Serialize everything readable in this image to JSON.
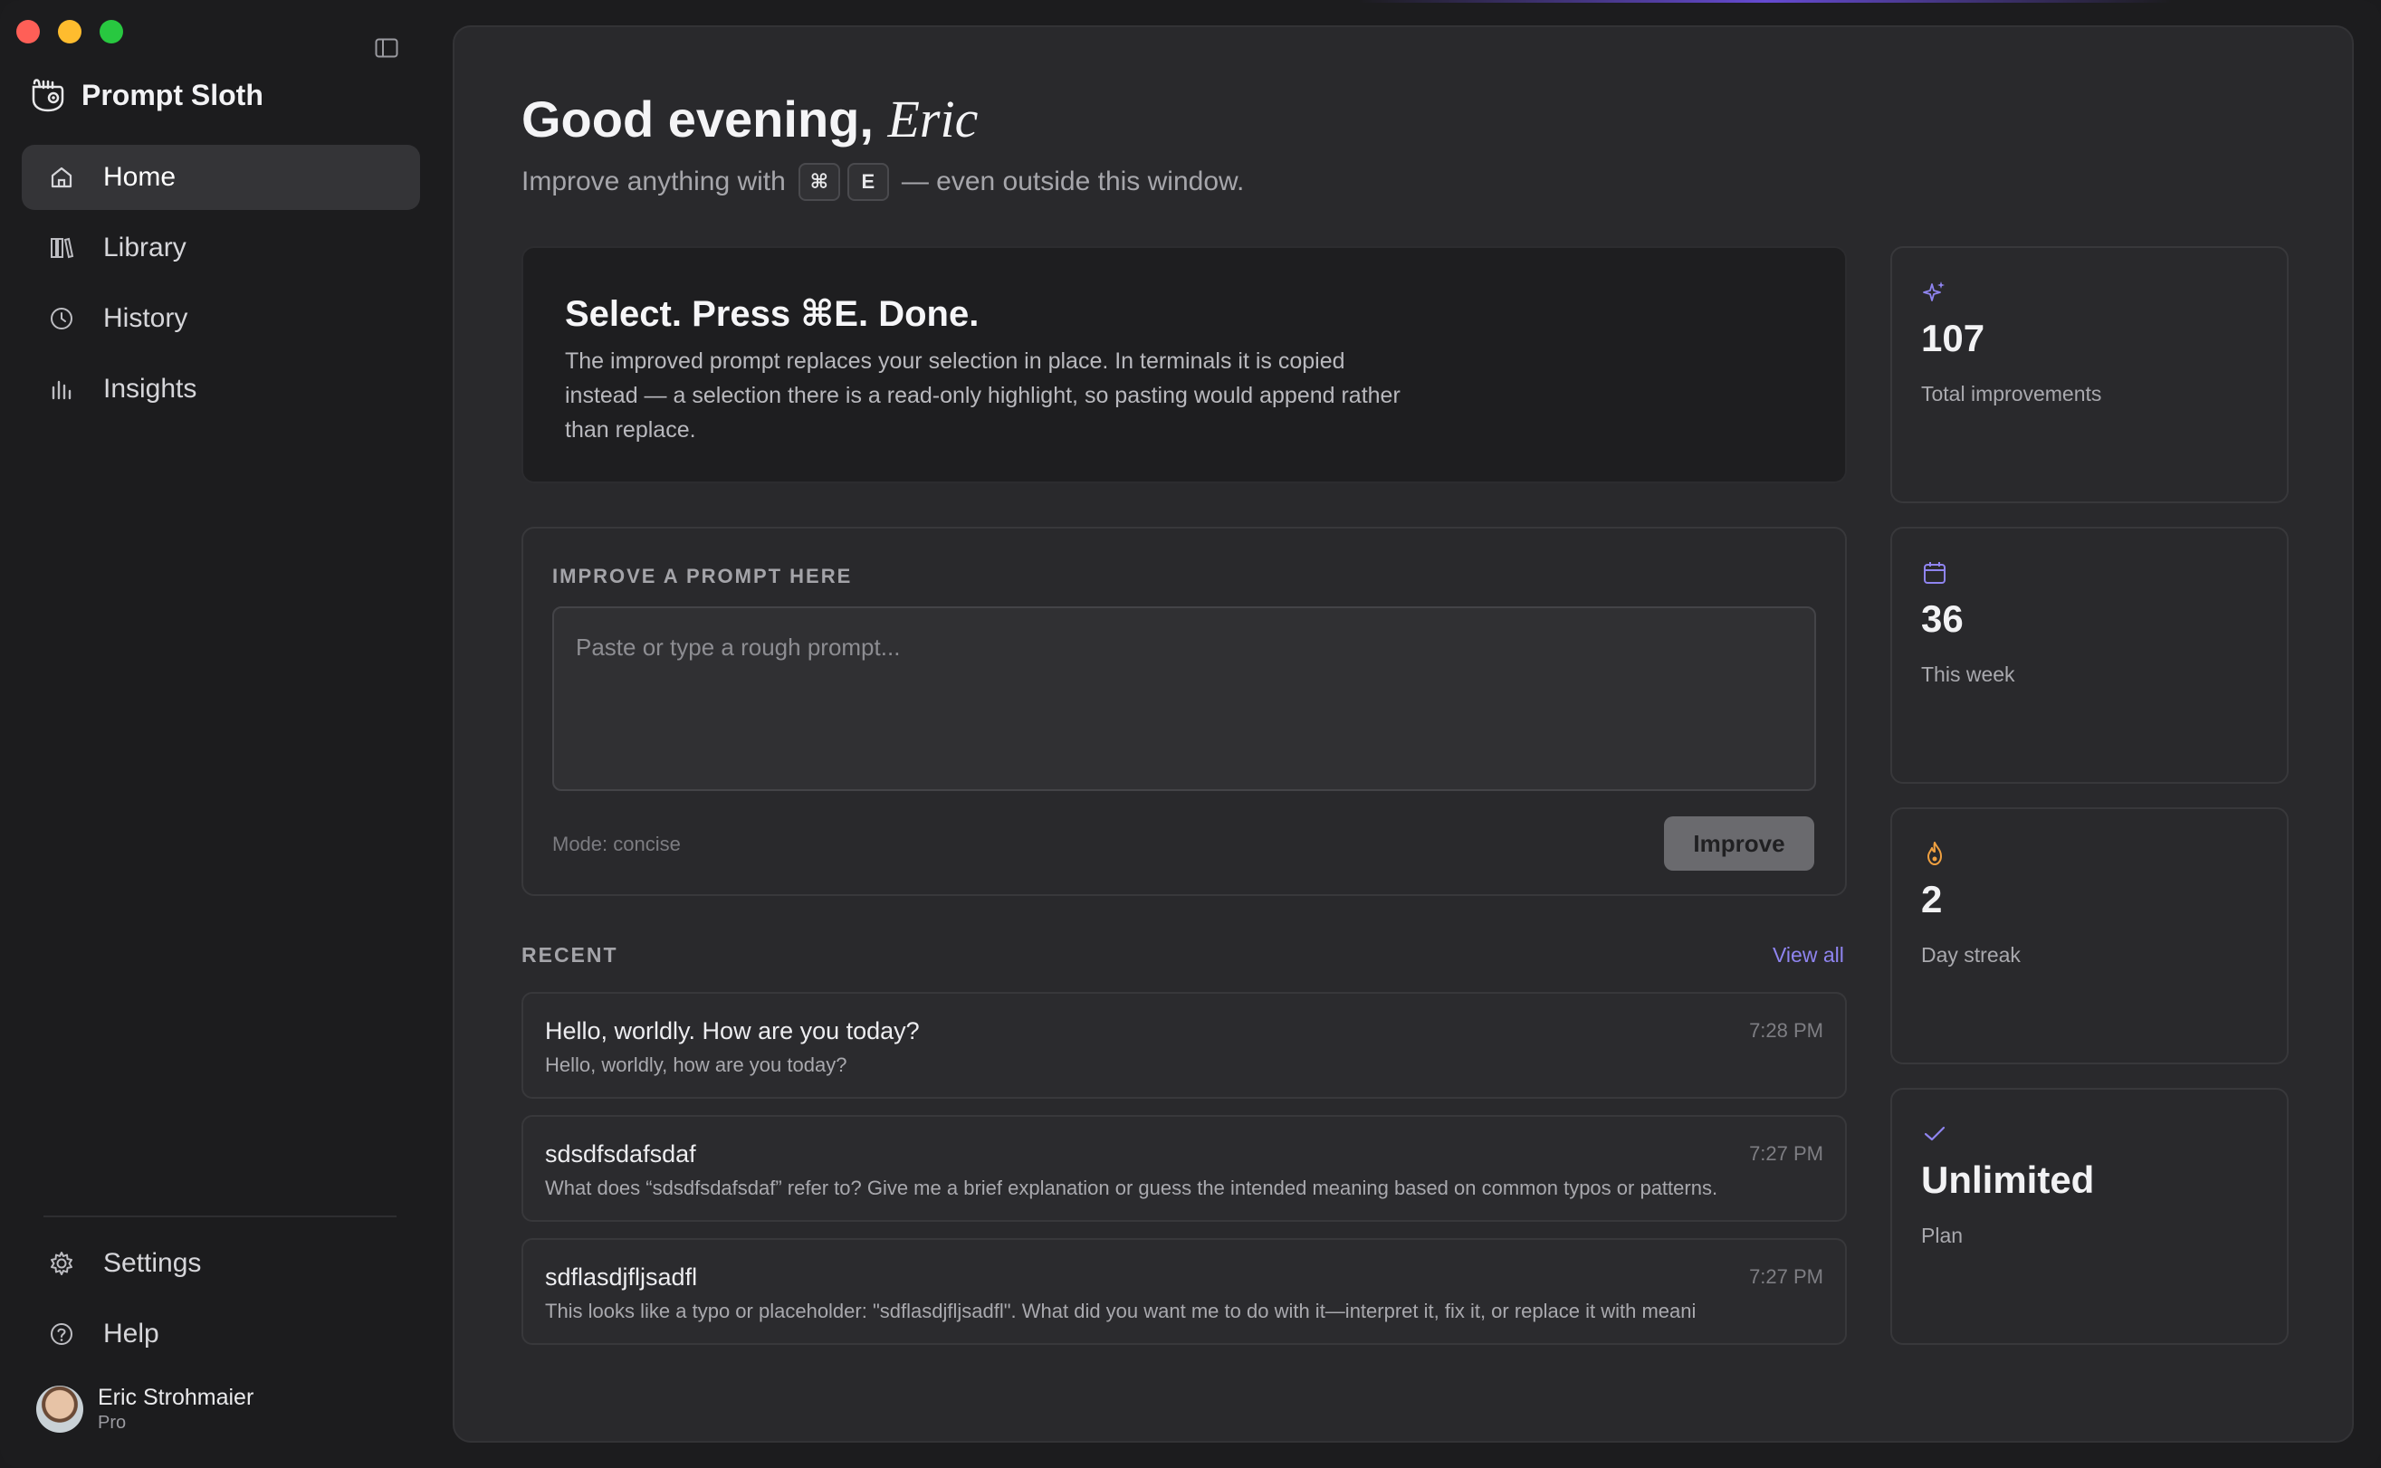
{
  "app": {
    "name": "Prompt Sloth"
  },
  "sidebar": {
    "items": [
      {
        "label": "Home"
      },
      {
        "label": "Library"
      },
      {
        "label": "History"
      },
      {
        "label": "Insights"
      }
    ],
    "bottom_items": [
      {
        "label": "Settings"
      },
      {
        "label": "Help"
      }
    ],
    "user": {
      "name": "Eric Strohmaier",
      "plan": "Pro"
    }
  },
  "header": {
    "greeting": "Good evening,",
    "name": "Eric",
    "subline_prefix": "Improve anything with",
    "key1": "⌘",
    "key2": "E",
    "subline_suffix": "— even outside this window."
  },
  "hero": {
    "title": "Select. Press ⌘E. Done.",
    "body": "The improved prompt replaces your selection in place. In terminals it is copied instead — a selection there is a read-only highlight, so pasting would append rather than replace."
  },
  "improve": {
    "label": "IMPROVE A PROMPT HERE",
    "placeholder": "Paste or type a rough prompt...",
    "mode": "Mode: concise",
    "button": "Improve"
  },
  "recent": {
    "label": "RECENT",
    "view_all": "View all",
    "items": [
      {
        "title": "Hello, worldly. How are you today?",
        "subtitle": "Hello, worldly, how are you today?",
        "time": "7:28 PM"
      },
      {
        "title": "sdsdfsdafsdaf",
        "subtitle": "What does “sdsdfsdafsdaf” refer to? Give me a brief explanation or guess the intended meaning based on common typos or patterns.",
        "time": "7:27 PM"
      },
      {
        "title": "sdflasdjfljsadfl",
        "subtitle": "This looks like a typo or placeholder: \"sdflasdjfljsadfl\". What did you want me to do with it—interpret it, fix it, or replace it with meani",
        "time": "7:27 PM"
      }
    ]
  },
  "stats": [
    {
      "icon": "sparkle-icon",
      "value": "107",
      "label": "Total improvements"
    },
    {
      "icon": "calendar-icon",
      "value": "36",
      "label": "This week"
    },
    {
      "icon": "flame-icon",
      "value": "2",
      "label": "Day streak"
    },
    {
      "icon": "check-icon",
      "value": "Unlimited",
      "label": "Plan"
    }
  ],
  "colors": {
    "accent": "#8f84f0",
    "streak": "#f0a040"
  }
}
